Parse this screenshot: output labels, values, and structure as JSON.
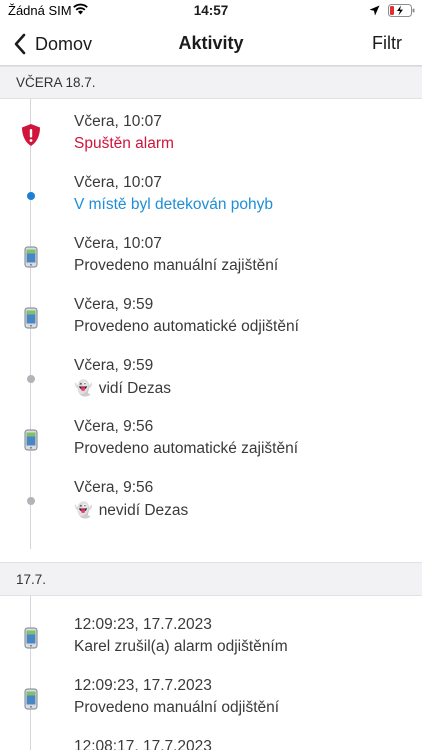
{
  "status_bar": {
    "carrier": "Žádná SIM",
    "time": "14:57",
    "icons": [
      "wifi-icon",
      "location-arrow-icon",
      "battery-charging-icon"
    ]
  },
  "nav": {
    "back_label": "Domov",
    "title": "Aktivity",
    "filter_label": "Filtr"
  },
  "colors": {
    "alarm": "#d0143c",
    "motion": "#1e8ed8",
    "section_bg": "#f2f2f5"
  },
  "sections": [
    {
      "header": "VČERA 18.7.",
      "items": [
        {
          "time": "Včera, 10:07",
          "desc": "Spuštěn alarm",
          "icon": "shield-alert-icon",
          "style": "alarm"
        },
        {
          "time": "Včera, 10:07",
          "desc": "V místě byl detekován pohyb",
          "icon": "blue-dot-icon",
          "style": "motion"
        },
        {
          "time": "Včera, 10:07",
          "desc": "Provedeno manuální zajištění",
          "icon": "phone-icon",
          "style": "normal"
        },
        {
          "time": "Včera, 9:59",
          "desc": "Provedeno automatické odjištění",
          "icon": "phone-icon",
          "style": "normal"
        },
        {
          "time": "Včera, 9:59",
          "desc": "vidí Dezas",
          "icon": "gray-dot-icon",
          "style": "normal",
          "emoji": "👻"
        },
        {
          "time": "Včera, 9:56",
          "desc": "Provedeno automatické zajištění",
          "icon": "phone-icon",
          "style": "normal"
        },
        {
          "time": "Včera, 9:56",
          "desc": "nevidí Dezas",
          "icon": "gray-dot-icon",
          "style": "normal",
          "emoji": "👻"
        }
      ]
    },
    {
      "header": "17.7.",
      "items": [
        {
          "time": "12:09:23, 17.7.2023",
          "desc": "Karel zrušil(a) alarm odjištěním",
          "icon": "phone-icon",
          "style": "normal"
        },
        {
          "time": "12:09:23, 17.7.2023",
          "desc": "Provedeno manuální odjištění",
          "icon": "phone-icon",
          "style": "normal"
        },
        {
          "time": "12:08:17, 17.7.2023",
          "desc": "",
          "icon": "phone-icon",
          "style": "normal"
        }
      ]
    }
  ]
}
